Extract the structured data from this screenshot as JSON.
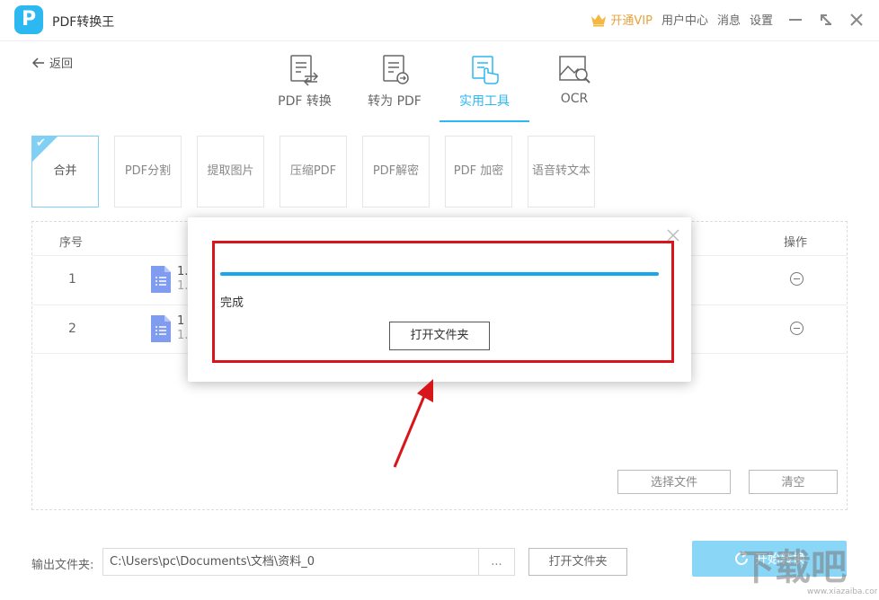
{
  "app": {
    "title": "PDF转换王",
    "logo_letter": "P"
  },
  "titlebar": {
    "vip": "开通VIP",
    "user_center": "用户中心",
    "messages": "消息",
    "settings": "设置"
  },
  "nav": {
    "back": "返回"
  },
  "tabs": [
    {
      "label": "PDF 转换",
      "active": false
    },
    {
      "label": "转为 PDF",
      "active": false
    },
    {
      "label": "实用工具",
      "active": true
    },
    {
      "label": "OCR",
      "active": false
    }
  ],
  "tools": [
    {
      "label": "合并",
      "active": true
    },
    {
      "label": "PDF分割",
      "active": false
    },
    {
      "label": "提取图片",
      "active": false
    },
    {
      "label": "压缩PDF",
      "active": false
    },
    {
      "label": "PDF解密",
      "active": false
    },
    {
      "label": "PDF 加密",
      "active": false
    },
    {
      "label": "语音转文本",
      "active": false
    }
  ],
  "table": {
    "headers": {
      "index": "序号",
      "action": "操作"
    },
    "rows": [
      {
        "index": "1",
        "name_line1": "1.",
        "name_line2": "1."
      },
      {
        "index": "2",
        "name_line1": "1",
        "name_line2": "1."
      }
    ],
    "select_files": "选择文件",
    "clear": "清空"
  },
  "output": {
    "label": "输出文件夹:",
    "path": "C:\\Users\\pc\\Documents\\文档\\资料_0",
    "more": "...",
    "open_folder": "打开文件夹",
    "start": "开始转换"
  },
  "modal": {
    "progress": 1.0,
    "status": "完成",
    "open_folder": "打开文件夹"
  },
  "colors": {
    "accent": "#2cb8f0",
    "progress": "#17a7ec",
    "annotation": "#d8151a",
    "vip": "#e8a33e"
  },
  "watermark": "下载吧",
  "icons": [
    "crown-icon",
    "minimize-icon",
    "maximize-icon",
    "close-icon",
    "back-arrow-icon",
    "pdf-convert-icon",
    "to-pdf-icon",
    "tools-icon",
    "ocr-icon",
    "checkmark-icon",
    "doc-icon",
    "remove-icon",
    "refresh-icon"
  ]
}
